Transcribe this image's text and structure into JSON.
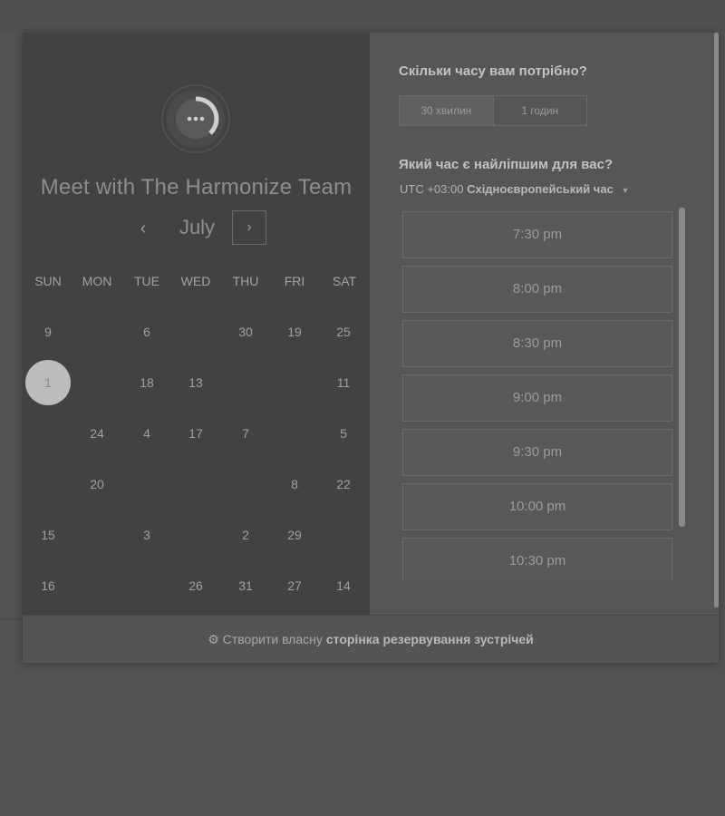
{
  "team": {
    "name": "Meet with The Harmonize Team"
  },
  "calendar": {
    "month": "July",
    "prev_icon": "chevron-left-icon",
    "next_icon": "chevron-right-icon",
    "prev_glyph": "‹",
    "next_glyph": "›",
    "weekdays": [
      "SUN",
      "MON",
      "TUE",
      "WED",
      "THU",
      "FRI",
      "SAT"
    ],
    "rows": [
      [
        "9",
        "",
        "6",
        "",
        "30",
        "19",
        "25"
      ],
      [
        "1",
        "",
        "18",
        "13",
        "",
        "",
        "11"
      ],
      [
        "",
        "24",
        "4",
        "17",
        "7",
        "",
        "5"
      ],
      [
        "",
        "20",
        "",
        "",
        "",
        "8",
        "22"
      ],
      [
        "15",
        "",
        "3",
        "",
        "2",
        "29",
        ""
      ],
      [
        "16",
        "",
        "",
        "26",
        "31",
        "27",
        "14"
      ]
    ],
    "selected_day": "1"
  },
  "duration": {
    "question": "Скільки часу вам потрібно?",
    "options": [
      "30 хвилин",
      "1 годин"
    ],
    "selected": "30 хвилин"
  },
  "time": {
    "question": "Який час є найліпшим для вас?",
    "tz_offset": "UTC +03:00",
    "tz_name": "Східноєвропейський час",
    "slots": [
      "7:30 pm",
      "8:00 pm",
      "8:30 pm",
      "9:00 pm",
      "9:30 pm",
      "10:00 pm",
      "10:30 pm"
    ]
  },
  "footer": {
    "prefix": "Створити власну",
    "link": "сторінка резервування зустрічей",
    "icon": "sprocket-icon"
  }
}
